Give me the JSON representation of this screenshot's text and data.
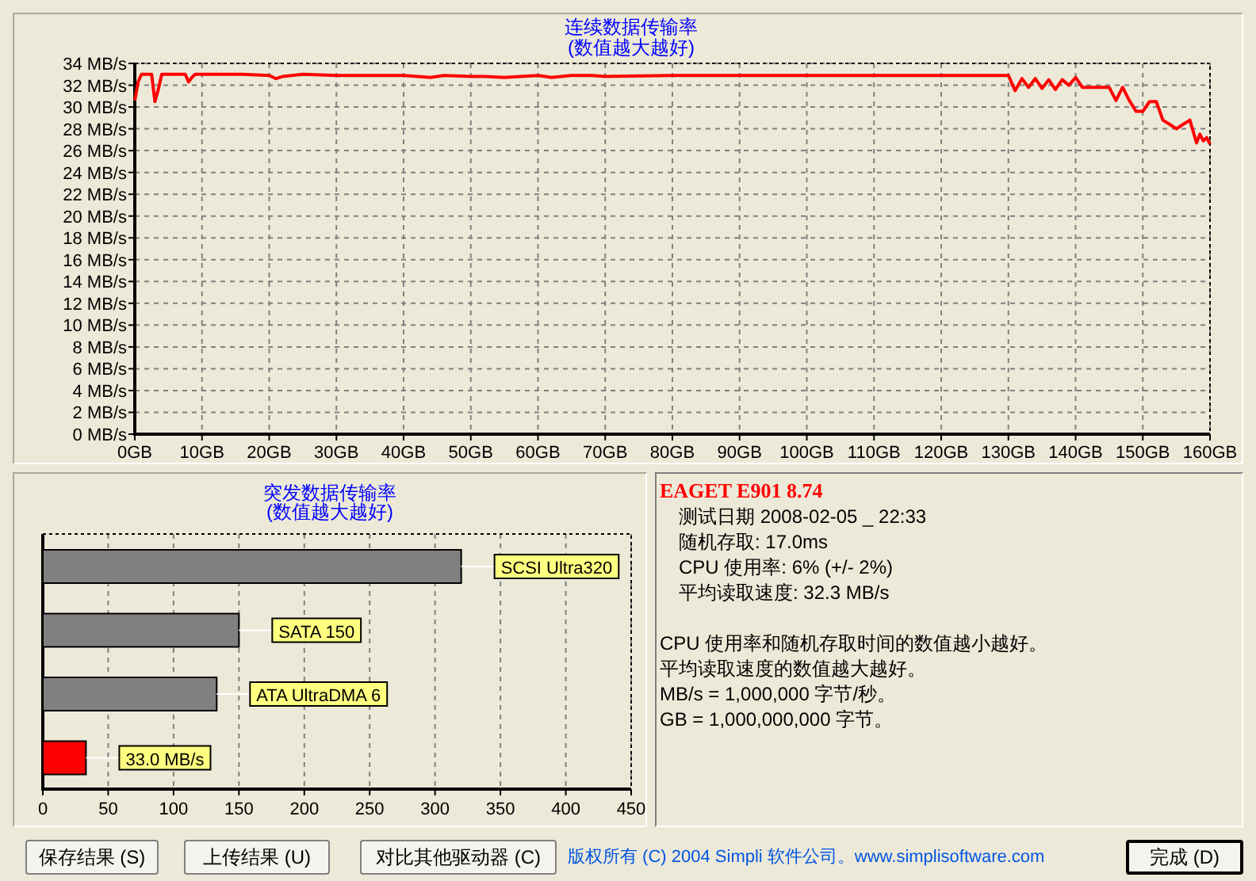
{
  "transfer_panel": {
    "subtitle": "(数值越大越好)",
    "chart_data": {
      "type": "line",
      "title": "连续数据传输率",
      "x": [
        0,
        0.5,
        1,
        2,
        2.5,
        3,
        3.5,
        4,
        6,
        7.5,
        8,
        8.5,
        9,
        12,
        16,
        20,
        21,
        22,
        25,
        30,
        40,
        44,
        46,
        50,
        52,
        55,
        60,
        62,
        65,
        68,
        70,
        80,
        90,
        100,
        110,
        120,
        125,
        130,
        131,
        132,
        133,
        134,
        135,
        136,
        137,
        138,
        139,
        140,
        141,
        142,
        143,
        144,
        145,
        146,
        147,
        148,
        149,
        150,
        151,
        152,
        153,
        154,
        155,
        156,
        157,
        158,
        158.5,
        159,
        159.5,
        160
      ],
      "series": [
        {
          "color": "#ff0000",
          "values": [
            30.6,
            32.3,
            33,
            33,
            33,
            30.5,
            31.6,
            33,
            33,
            33,
            32.3,
            32.7,
            33,
            33,
            33,
            32.9,
            32.6,
            32.8,
            33,
            32.9,
            32.9,
            32.7,
            32.9,
            32.8,
            32.8,
            32.7,
            32.9,
            32.7,
            32.9,
            32.9,
            32.8,
            32.9,
            32.9,
            32.9,
            32.9,
            32.9,
            32.9,
            32.9,
            31.5,
            32.6,
            31.8,
            32.6,
            31.7,
            32.5,
            31.6,
            32.5,
            32,
            32.7,
            31.8,
            31.8,
            31.8,
            31.8,
            31.8,
            30.6,
            31.8,
            30.6,
            29.6,
            29.6,
            30.5,
            30.5,
            28.8,
            28.4,
            28,
            28.4,
            28.8,
            26.7,
            27.5,
            26.9,
            27.2,
            26.6
          ]
        }
      ],
      "xlim": [
        0,
        160
      ],
      "ylim": [
        0,
        34
      ],
      "grid": true,
      "xticks": [
        {
          "value": 0,
          "label": "0GB"
        },
        {
          "value": 10,
          "label": "10GB"
        },
        {
          "value": 20,
          "label": "20GB"
        },
        {
          "value": 30,
          "label": "30GB"
        },
        {
          "value": 40,
          "label": "40GB"
        },
        {
          "value": 50,
          "label": "50GB"
        },
        {
          "value": 60,
          "label": "60GB"
        },
        {
          "value": 70,
          "label": "70GB"
        },
        {
          "value": 80,
          "label": "80GB"
        },
        {
          "value": 90,
          "label": "90GB"
        },
        {
          "value": 100,
          "label": "100GB"
        },
        {
          "value": 110,
          "label": "110GB"
        },
        {
          "value": 120,
          "label": "120GB"
        },
        {
          "value": 130,
          "label": "130GB"
        },
        {
          "value": 140,
          "label": "140GB"
        },
        {
          "value": 150,
          "label": "150GB"
        },
        {
          "value": 160,
          "label": "160GB"
        }
      ],
      "yticks": [
        {
          "value": 0,
          "label": "0 MB/s"
        },
        {
          "value": 2,
          "label": "2 MB/s"
        },
        {
          "value": 4,
          "label": "4 MB/s"
        },
        {
          "value": 6,
          "label": "6 MB/s"
        },
        {
          "value": 8,
          "label": "8 MB/s"
        },
        {
          "value": 10,
          "label": "10 MB/s"
        },
        {
          "value": 12,
          "label": "12 MB/s"
        },
        {
          "value": 14,
          "label": "14 MB/s"
        },
        {
          "value": 16,
          "label": "16 MB/s"
        },
        {
          "value": 18,
          "label": "18 MB/s"
        },
        {
          "value": 20,
          "label": "20 MB/s"
        },
        {
          "value": 22,
          "label": "22 MB/s"
        },
        {
          "value": 24,
          "label": "24 MB/s"
        },
        {
          "value": 26,
          "label": "26 MB/s"
        },
        {
          "value": 28,
          "label": "28 MB/s"
        },
        {
          "value": 30,
          "label": "30 MB/s"
        },
        {
          "value": 32,
          "label": "32 MB/s"
        },
        {
          "value": 34,
          "label": "34 MB/s"
        }
      ]
    }
  },
  "burst_panel": {
    "subtitle": "(数值越大越好)",
    "chart_data": {
      "type": "bar",
      "orientation": "horizontal",
      "title": "突发数据传输率",
      "categories": [
        "SCSI Ultra320",
        "SATA 150",
        "ATA UltraDMA 6",
        "33.0 MB/s"
      ],
      "series": [
        {
          "color": "#808080",
          "values": [
            320,
            150,
            133,
            null
          ]
        },
        {
          "color": "#ff0000",
          "values": [
            null,
            null,
            null,
            33
          ]
        }
      ],
      "xlim": [
        0,
        450
      ],
      "xticks": [
        0,
        50,
        100,
        150,
        200,
        250,
        300,
        350,
        400,
        450
      ],
      "grid": true
    }
  },
  "results": {
    "drive": "EAGET E901 8.74",
    "details": [
      "测试日期 2008-02-05 _ 22:33",
      "随机存取: 17.0ms",
      "CPU 使用率: 6% (+/- 2%)",
      "平均读取速度: 32.3 MB/s"
    ],
    "notes": [
      "CPU 使用率和随机存取时间的数值越小越好。",
      "平均读取速度的数值越大越好。",
      "MB/s = 1,000,000 字节/秒。",
      "GB = 1,000,000,000 字节。"
    ]
  },
  "buttons": [
    {
      "label": "保存结果 (S)"
    },
    {
      "label": "上传结果 (U)"
    },
    {
      "label": "对比其他驱动器 (C)"
    }
  ],
  "copyright": "版权所有 (C) 2004 Simpli 软件公司。www.simplisoftware.com",
  "done_button": {
    "label": "完成 (D)",
    "default": true
  }
}
